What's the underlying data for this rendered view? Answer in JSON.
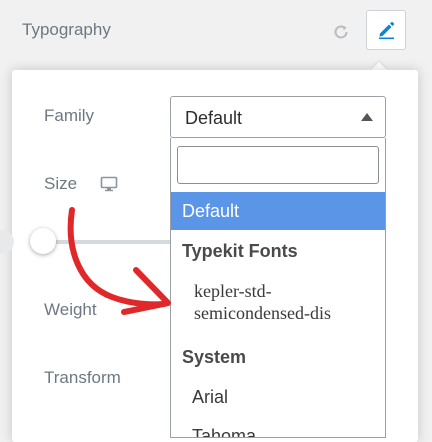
{
  "header": {
    "title": "Typography",
    "reset_icon": "reset-icon",
    "edit_icon": "pencil-icon",
    "accent_color": "#0a86d4"
  },
  "controls": {
    "family_label": "Family",
    "size_label": "Size",
    "size_device_icon": "desktop-icon",
    "weight_label": "Weight",
    "transform_label": "Transform"
  },
  "family_select": {
    "value": "Default",
    "search_value": "",
    "options": [
      {
        "label": "Default",
        "selected": true
      },
      {
        "group": "Typekit Fonts"
      },
      {
        "label": "kepler-std-semicondensed-dis"
      },
      {
        "group": "System"
      },
      {
        "label": "Arial"
      },
      {
        "label": "Tahoma"
      }
    ],
    "kepler_line1": "kepler-std-",
    "kepler_line2": "semicondensed-dis",
    "highlight_color": "#5a95e8"
  },
  "size_slider": {
    "value_fraction": 0
  },
  "annotation": {
    "arrow_color": "#e0282a"
  }
}
